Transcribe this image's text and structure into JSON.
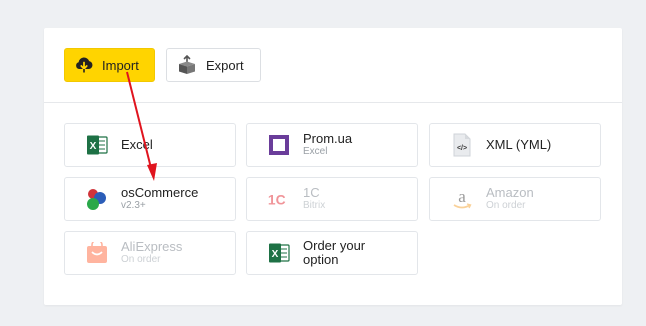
{
  "toolbar": {
    "import_label": "Import",
    "export_label": "Export"
  },
  "sources": [
    {
      "title": "Excel",
      "subtitle": "",
      "icon": "excel-icon",
      "enabled": true
    },
    {
      "title": "Prom.ua",
      "subtitle": "Excel",
      "icon": "prom-icon",
      "enabled": true
    },
    {
      "title": "XML (YML)",
      "subtitle": "",
      "icon": "xml-file-icon",
      "enabled": true
    },
    {
      "title": "osCommerce",
      "subtitle": "v2.3+",
      "icon": "oscommerce-icon",
      "enabled": true
    },
    {
      "title": "1C",
      "subtitle": "Bitrix",
      "icon": "1c-icon",
      "enabled": false
    },
    {
      "title": "Amazon",
      "subtitle": "On order",
      "icon": "amazon-icon",
      "enabled": false
    },
    {
      "title": "AliExpress",
      "subtitle": "On order",
      "icon": "aliexpress-icon",
      "enabled": false
    },
    {
      "title": "Order your option",
      "subtitle": "",
      "icon": "excel-icon",
      "enabled": true
    }
  ],
  "colors": {
    "accent": "#ffd400",
    "excel_green": "#1e7145",
    "prom_purple": "#6a3d9a",
    "annotation_red": "#e0141e"
  }
}
